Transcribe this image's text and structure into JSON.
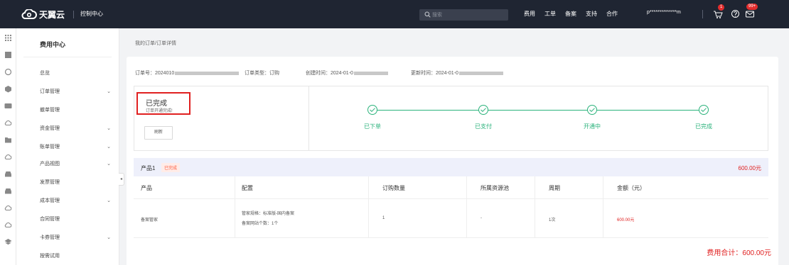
{
  "topbar": {
    "logo_text": "天翼云",
    "console_link": "控制中心",
    "search_placeholder": "搜索",
    "nav": [
      "费用",
      "工单",
      "备案",
      "支持",
      "合作"
    ],
    "user": "p**************m",
    "cart_badge": "1",
    "msg_badge": "99+"
  },
  "sidebar": {
    "title": "费用中心",
    "items": [
      {
        "label": "总览",
        "has_children": false
      },
      {
        "label": "订单管理",
        "has_children": true
      },
      {
        "label": "撤单管理",
        "has_children": false
      },
      {
        "label": "资金管理",
        "has_children": true
      },
      {
        "label": "账单管理",
        "has_children": true
      },
      {
        "label": "产品视图",
        "has_children": true
      },
      {
        "label": "发票管理",
        "has_children": false
      },
      {
        "label": "成本管理",
        "has_children": true
      },
      {
        "label": "合同管理",
        "has_children": false
      },
      {
        "label": "卡券管理",
        "has_children": true
      },
      {
        "label": "按需试用",
        "has_children": false
      }
    ]
  },
  "breadcrumb": "我的订单/订单详情",
  "order": {
    "id_label": "订单号：",
    "id_value": "2024010",
    "type_label": "订单类型：",
    "type_value": "订购",
    "created_label": "创建时间：",
    "created_value": "2024-01-0",
    "updated_label": "更新时间：",
    "updated_value": "2024-01-0"
  },
  "status": {
    "title": "已完成",
    "subtitle": "订单开通完成!",
    "refresh_label": "刷新",
    "steps": [
      "已下单",
      "已支付",
      "开通中",
      "已完成"
    ]
  },
  "product": {
    "name": "产品1",
    "tag": "已完成",
    "total": "600.00元"
  },
  "table": {
    "headers": [
      "产品",
      "配置",
      "订购数量",
      "所属资源池",
      "周期",
      "金额（元）"
    ],
    "row": {
      "product": "备案管家",
      "config_line1": "管家规格：标准版-国内备案",
      "config_line2": "备案网站个数：1个",
      "quantity": "1",
      "pool": "-",
      "period": "1次",
      "amount": "600.00元"
    }
  },
  "fee_total": "费用合计：600.00元",
  "colors": {
    "accent": "#2ab27b",
    "danger": "#e02020",
    "topbar": "#1f2532"
  }
}
